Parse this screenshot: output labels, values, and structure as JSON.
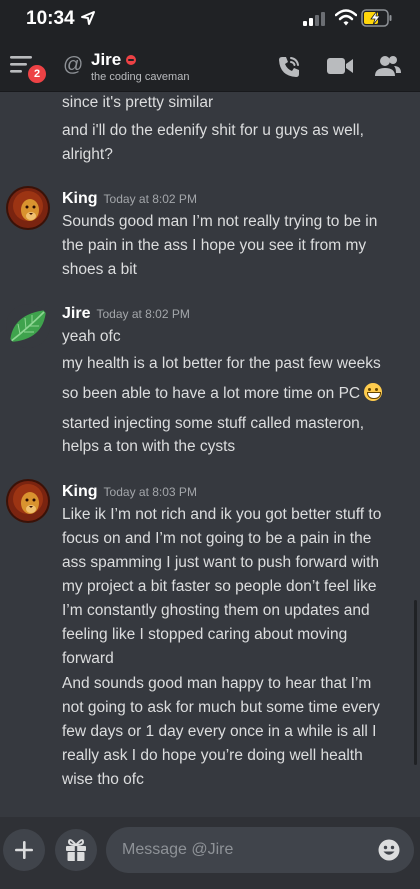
{
  "status_bar": {
    "time": "10:34"
  },
  "header": {
    "unread_count": "2",
    "recipient_name": "Jire",
    "recipient_status": "the coding caveman",
    "icons": [
      "hamburger-menu-icon",
      "at-icon",
      "phone-call-icon",
      "video-camera-icon",
      "members-icon"
    ]
  },
  "messages": {
    "continued": [
      "since it's pretty similar",
      "and i'll do the edenify shit for u guys as well,",
      "alright?"
    ],
    "group1": {
      "author": "King",
      "timestamp": "Today at 8:02 PM",
      "lines": [
        "Sounds good man I’m not really trying to be in",
        "the pain in the ass I hope you see it from my",
        "shoes a bit"
      ]
    },
    "group2": {
      "author": "Jire",
      "timestamp": "Today at 8:02 PM",
      "lines": [
        "yeah ofc",
        "my health is a lot better for the past few weeks",
        "so been able to have a lot more time on PC",
        "started injecting some stuff called masteron,",
        "helps a ton with the cysts"
      ]
    },
    "group3": {
      "author": "King",
      "timestamp": "Today at 8:03 PM",
      "lines": [
        "Like ik I’m not rich and ik you got better stuff to",
        "focus on and I’m not going to be a pain in the",
        "ass spamming I just want to push forward with",
        "my project a bit faster so people don’t feel like",
        "I’m constantly ghosting them on updates and",
        "feeling like I stopped caring about moving",
        "forward",
        "And sounds good man happy to hear that I’m",
        "not going to ask for much but some time every",
        "few days or 1 day every once in a while is all I",
        "really ask I do hope you’re doing well health",
        "wise tho ofc"
      ]
    }
  },
  "composer": {
    "placeholder": "Message @Jire",
    "icons": [
      "plus-icon",
      "gift-icon",
      "emoji-icon"
    ]
  },
  "colors": {
    "background": "#36393f",
    "header": "#202225",
    "composer_bar": "#2f3136",
    "input": "#40444b",
    "dnd_red": "#ed4245"
  }
}
